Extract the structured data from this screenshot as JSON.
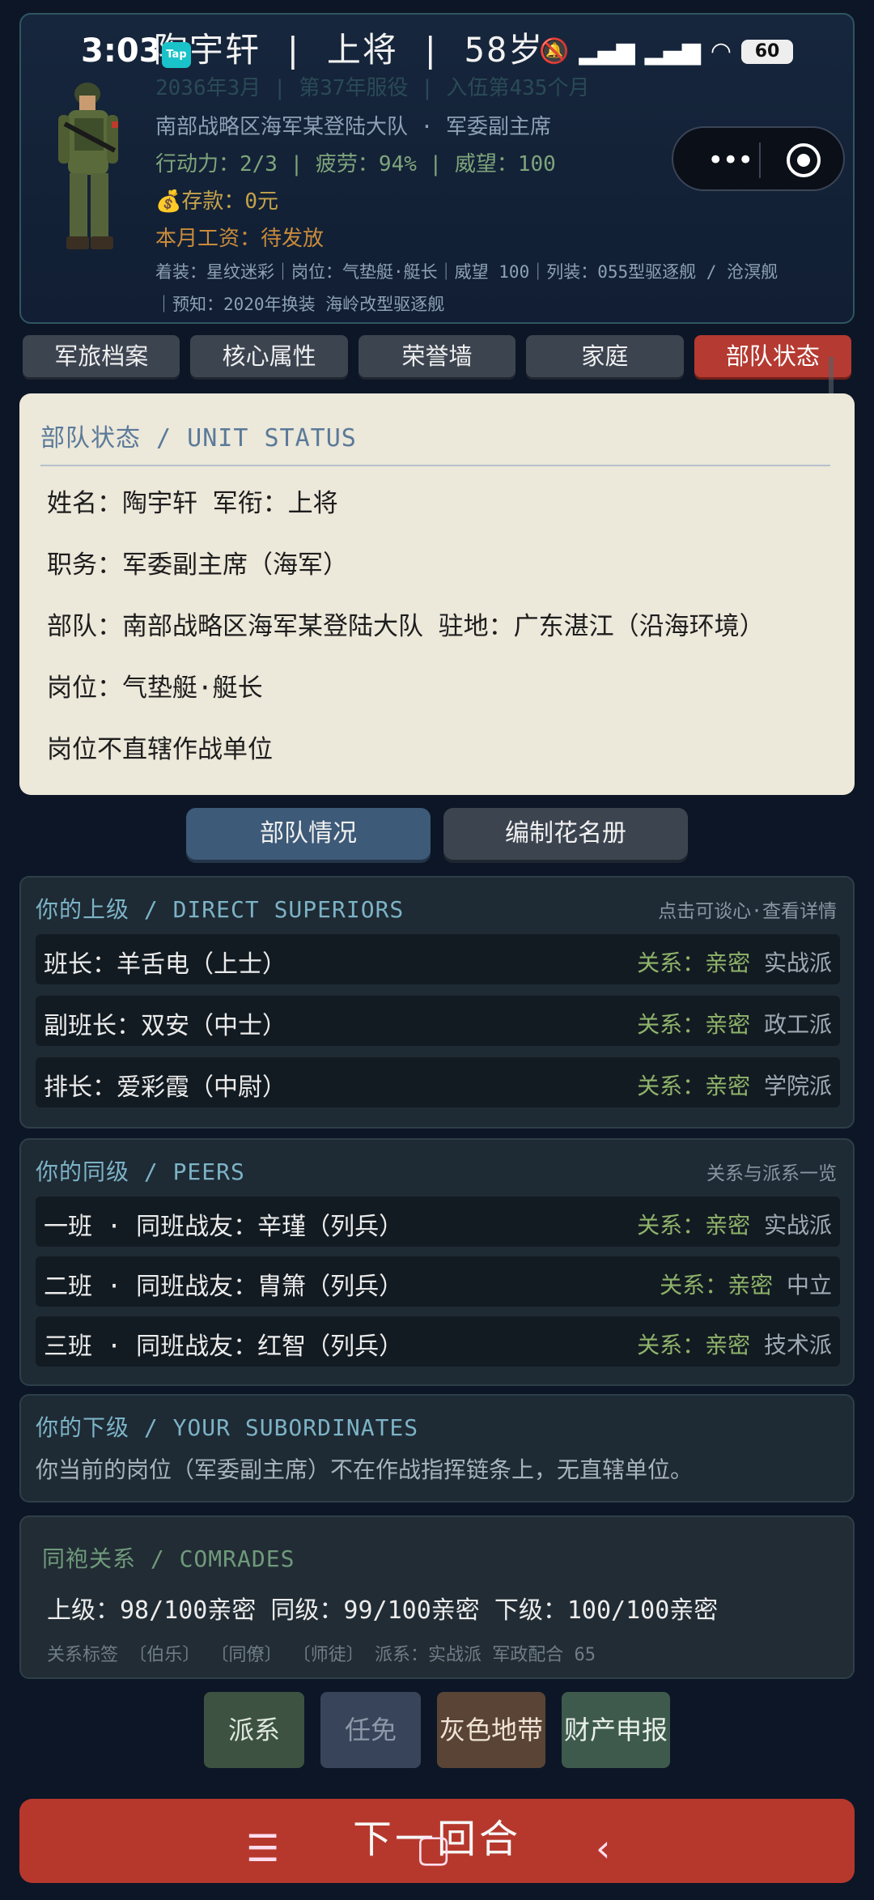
{
  "status_bar": {
    "time": "3:03",
    "tap_badge": "Tap",
    "battery": "60",
    "title": "陶宇轩  |  上将  |  58岁"
  },
  "header": {
    "faded_line": "2036年3月 | 第37年服役 | 入伍第435个月",
    "unit_line": "南部战略区海军某登陆大队 · 军委副主席",
    "stats_line": "行动力：2/3 | 疲劳：94% | 威望：100",
    "savings": "💰存款：0元",
    "salary": "本月工资：待发放",
    "detail_line1": "着装：星纹迷彩｜岗位：气垫艇·艇长｜威望 100｜列装：055型驱逐舰 / 沧溟舰",
    "detail_line2": "｜预知：2020年换装 海岭改型驱逐舰"
  },
  "tabs": [
    "军旅档案",
    "核心属性",
    "荣誉墙",
    "家庭",
    "部队状态"
  ],
  "status_panel": {
    "title": "部队状态 / UNIT STATUS",
    "lines": [
      "姓名：陶宇轩  军衔：上将",
      "职务：军委副主席（海军）",
      "部队：南部战略区海军某登陆大队  驻地：广东湛江（沿海环境）",
      "岗位：气垫艇·艇长",
      "岗位不直辖作战单位"
    ]
  },
  "segments": {
    "on": "部队情况",
    "off": "编制花名册"
  },
  "superiors": {
    "title": "你的上级 / DIRECT SUPERIORS",
    "hint": "点击可谈心·查看详情",
    "rows": [
      {
        "name": "班长：羊舌电（上士）",
        "rel": "关系：亲密",
        "faction": "实战派"
      },
      {
        "name": "副班长：双安（中士）",
        "rel": "关系：亲密",
        "faction": "政工派"
      },
      {
        "name": "排长：爱彩霞（中尉）",
        "rel": "关系：亲密",
        "faction": "学院派"
      }
    ]
  },
  "peers": {
    "title": "你的同级 / PEERS",
    "hint": "关系与派系一览",
    "rows": [
      {
        "name": "一班 · 同班战友：辛瑾（列兵）",
        "rel": "关系：亲密",
        "faction": "实战派"
      },
      {
        "name": "二班 · 同班战友：胄箫（列兵）",
        "rel": "关系：亲密",
        "faction": "中立"
      },
      {
        "name": "三班 · 同班战友：红智（列兵）",
        "rel": "关系：亲密",
        "faction": "技术派"
      }
    ]
  },
  "subordinates": {
    "title": "你的下级 / YOUR SUBORDINATES",
    "text": "你当前的岗位（军委副主席）不在作战指挥链条上，无直辖单位。"
  },
  "comrades": {
    "title": "同袍关系 / COMRADES",
    "line": "上级：98/100亲密  同级：99/100亲密  下级：100/100亲密",
    "tags": "关系标签  〔伯乐〕 〔同僚〕 〔师徒〕  派系：实战派  军政配合 65"
  },
  "actions": [
    "派系",
    "任免",
    "灰色地带",
    "财产申报"
  ],
  "next_turn": "下一回合",
  "nav": {
    "menu": "☰",
    "home": "▢",
    "back": "‹"
  }
}
